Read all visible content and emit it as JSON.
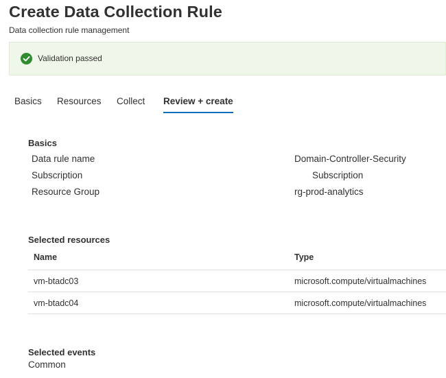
{
  "header": {
    "title": "Create Data Collection Rule",
    "subtitle": "Data collection rule management"
  },
  "validation": {
    "message": "Validation passed",
    "status_color": "#2f8d2f"
  },
  "tabs": [
    {
      "label": "Basics",
      "active": false
    },
    {
      "label": "Resources",
      "active": false
    },
    {
      "label": "Collect",
      "active": false
    },
    {
      "label": "Review + create",
      "active": true
    }
  ],
  "basics": {
    "title": "Basics",
    "fields": [
      {
        "label": "Data rule name",
        "value": "Domain-Controller-Security"
      },
      {
        "label": "Subscription",
        "value": "Subscription"
      },
      {
        "label": "Resource Group",
        "value": "rg-prod-analytics"
      }
    ]
  },
  "selected_resources": {
    "title": "Selected resources",
    "columns": [
      "Name",
      "Type"
    ],
    "rows": [
      {
        "name": "vm-btadc03",
        "type": "microsoft.compute/virtualmachines"
      },
      {
        "name": "vm-btadc04",
        "type": "microsoft.compute/virtualmachines"
      }
    ]
  },
  "selected_events": {
    "title": "Selected events",
    "value": "Common"
  },
  "theme": {
    "accent": "#0f6cbd",
    "banner_bg": "#eff6ea"
  }
}
